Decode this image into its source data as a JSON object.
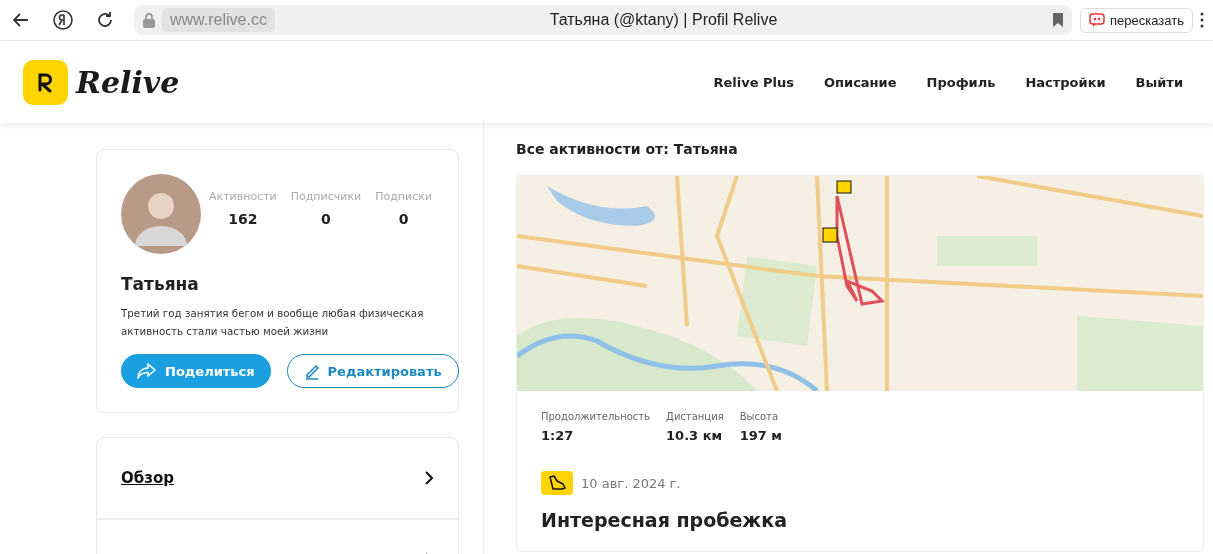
{
  "browser": {
    "address": "www.relive.cc",
    "title": "Татьяна (@ktany) | Profil Relive",
    "summarize_button": "пересказать"
  },
  "header": {
    "logo_text": "Relive",
    "nav": [
      {
        "label": "Relive Plus"
      },
      {
        "label": "Описание"
      },
      {
        "label": "Профиль"
      },
      {
        "label": "Настройки"
      },
      {
        "label": "Выйти"
      }
    ]
  },
  "profile": {
    "stats": [
      {
        "label": "Активности",
        "value": "162"
      },
      {
        "label": "Подписчики",
        "value": "0"
      },
      {
        "label": "Подписки",
        "value": "0"
      }
    ],
    "name": "Татьяна",
    "bio": "Третий год занятия бегом и вообще любая физическая активность стали частью моей жизни",
    "share_button": "Поделиться",
    "edit_button": "Редактировать"
  },
  "menu": [
    {
      "label": "Обзор"
    }
  ],
  "feed": {
    "heading": "Все активности от: Татьяна",
    "activity": {
      "stats": [
        {
          "label": "Продолжительность",
          "value": "1:27"
        },
        {
          "label": "Дистанция",
          "value": "10.3 км"
        },
        {
          "label": "Высота",
          "value": "197 м"
        }
      ],
      "date": "10 авг. 2024 г.",
      "title": "Интересная пробежка"
    }
  }
}
